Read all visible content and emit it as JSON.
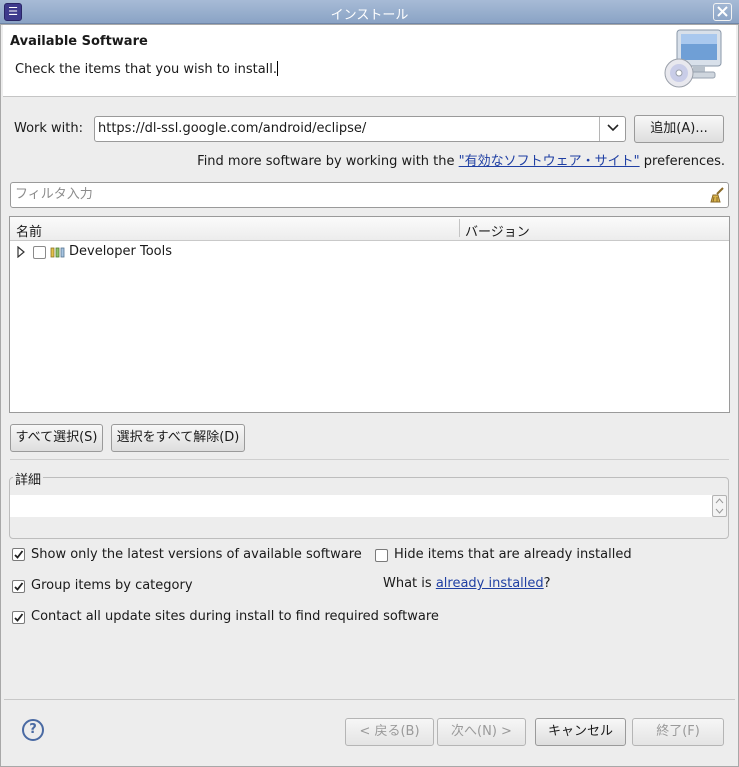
{
  "window": {
    "title": "インストール"
  },
  "banner": {
    "title": "Available Software",
    "description": "Check the items that you wish to install."
  },
  "work_with": {
    "label": "Work with:",
    "value": "https://dl-ssl.google.com/android/eclipse/",
    "add_label": "追加(A)..."
  },
  "find_more": {
    "prefix": "Find more software by working with the ",
    "link": "\"有効なソフトウェア・サイト\"",
    "suffix": " preferences."
  },
  "filter": {
    "placeholder": "フィルタ入力"
  },
  "tree": {
    "columns": [
      "名前",
      "バージョン"
    ],
    "rows": [
      {
        "label": "Developer Tools",
        "version": "",
        "checked": false,
        "expanded": false
      }
    ]
  },
  "selection_buttons": {
    "select_all": "すべて選択(S)",
    "deselect_all": "選択をすべて解除(D)"
  },
  "details": {
    "legend": "詳細",
    "text": ""
  },
  "options": {
    "latest_only": {
      "label": "Show only the latest versions of available software",
      "checked": true
    },
    "hide_installed": {
      "label": "Hide items that are already installed",
      "checked": false
    },
    "group_by_category": {
      "label": "Group items by category",
      "checked": true
    },
    "what_is_prefix": "What is ",
    "what_is_link": "already installed",
    "what_is_suffix": "?",
    "contact_all_sites": {
      "label": "Contact all update sites during install to find required software",
      "checked": true
    }
  },
  "footer": {
    "back": "< 戻る(B)",
    "next": "次へ(N) >",
    "cancel": "キャンセル",
    "finish": "終了(F)"
  },
  "colors": {
    "titlebar": "#8aa3c5",
    "link": "#1f3fa3",
    "dialog_bg": "#ededed"
  }
}
